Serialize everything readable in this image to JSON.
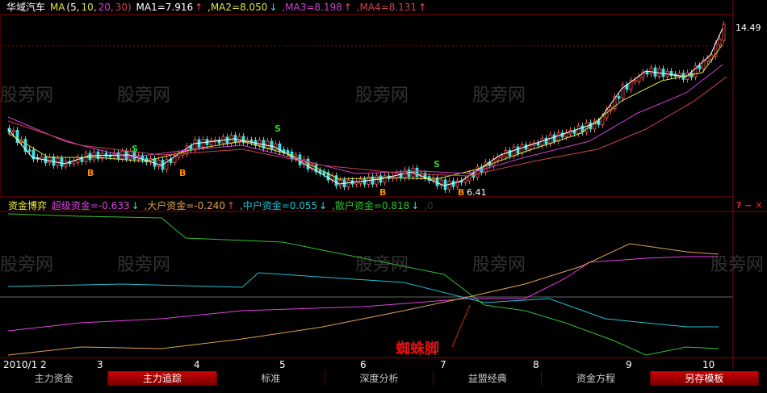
{
  "price_header": {
    "stock": "华域汽车",
    "ma": "MA",
    "ma_params": [
      "(5,",
      "10,",
      "20,",
      "30)"
    ],
    "ma1": "MA1=7.916",
    "ma1_arrow": "↑",
    "ma2": ",MA2=8.050",
    "ma2_arrow": "↓",
    "ma3": ",MA3=8.198",
    "ma3_arrow": "↑",
    "ma4": ",MA4=8.131",
    "ma4_arrow": "↑"
  },
  "price_labels": {
    "high": "14.49",
    "low": "6.41"
  },
  "signals": {
    "sell": "S",
    "buy": "B"
  },
  "indicator_header": {
    "name": "资金博弈",
    "super": "超级资金=-0.633",
    "super_arrow": "↓",
    "big": ",大户资金=-0.240",
    "big_arrow": "↑",
    "mid": ",中户资金=0.055",
    "mid_arrow": "↓",
    "retail": ",散户资金=0.818",
    "retail_arrow": "↓",
    "tail": ",0"
  },
  "annotation": "蜘蛛脚",
  "watermark": "股旁网",
  "x_axis": [
    "2010/1 2",
    "3",
    "4",
    "5",
    "6",
    "7",
    "8",
    "9",
    "10"
  ],
  "tabs": [
    {
      "label": "主力资金",
      "active": false
    },
    {
      "label": "主力追踪",
      "active": true
    },
    {
      "label": "标准",
      "active": false
    },
    {
      "label": "深度分析",
      "active": false
    },
    {
      "label": "益盟经典",
      "active": false
    },
    {
      "label": "资金方程",
      "active": false
    },
    {
      "label": "另存模板",
      "active": true
    }
  ],
  "colors": {
    "super": "#e040e0",
    "big": "#e0a050",
    "mid": "#20c0d0",
    "retail": "#30c030",
    "up": "#ff5050",
    "down": "#40e0e0"
  }
}
